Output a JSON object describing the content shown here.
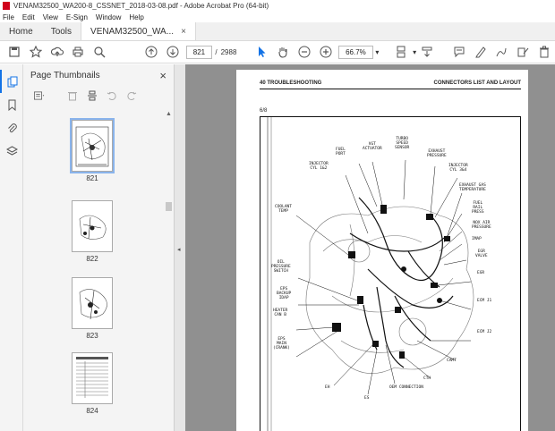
{
  "window": {
    "title": "VENAM32500_WA200-8_CSSNET_2018-03-08.pdf - Adobe Acrobat Pro (64-bit)"
  },
  "menu": [
    "File",
    "Edit",
    "View",
    "E-Sign",
    "Window",
    "Help"
  ],
  "tabs": {
    "home": "Home",
    "tools": "Tools",
    "document": "VENAM32500_WA...",
    "close": "×"
  },
  "toolbar": {
    "page_current": "821",
    "page_sep": "/",
    "page_total": "2988",
    "zoom": "66.7%"
  },
  "panel": {
    "title": "Page Thumbnails",
    "close": "×",
    "thumbnails": [
      {
        "label": "821",
        "selected": true
      },
      {
        "label": "822",
        "selected": false
      },
      {
        "label": "823",
        "selected": false
      },
      {
        "label": "824",
        "selected": false
      }
    ]
  },
  "document": {
    "header_left": "40 TROUBLESHOOTING",
    "header_right": "CONNECTORS LIST AND LAYOUT",
    "page_fraction": "6/8",
    "diagram_labels": {
      "fuel_port": "FUEL\nPORT",
      "vgt_actuator": "VGT\nACTUATOR",
      "turbo_speed": "TURBO\nSPEED\nSENSOR",
      "exhaust_pressure": "EXHAUST\nPRESSURE",
      "injector_cyl_123": "INJECTOR\nCYL 1&2",
      "injector_cyl_456": "INJECTOR\nCYL 3&4",
      "exhaust_gas_temp": "EXHAUST GAS\nTEMPERATURE",
      "fuel_rail_press": "FUEL\nRAIL\nPRESS",
      "coolant_temp": "COOLANT\nTEMP",
      "nox_pressure": "NOX AIR\nPRESSURE",
      "imap": "IMAP",
      "egr_valve": "EGR\nVALVE",
      "oil_pressure": "OIL\nPRESSURE\nSWITCH",
      "egr": "EGR",
      "ecm_j1": "ECM J1",
      "eps_backup": "EPS\nBACKUP\nIDAP",
      "heater_can_b": "HEATER\nCAN B",
      "ecm_j2": "ECM J2",
      "eps_main": "EPS\nMAIN\n(CRANK)",
      "camt": "CAMT",
      "eh": "EH",
      "oem_connection": "OEM CONNECTION",
      "cth": "CTH",
      "es": "ES"
    }
  }
}
